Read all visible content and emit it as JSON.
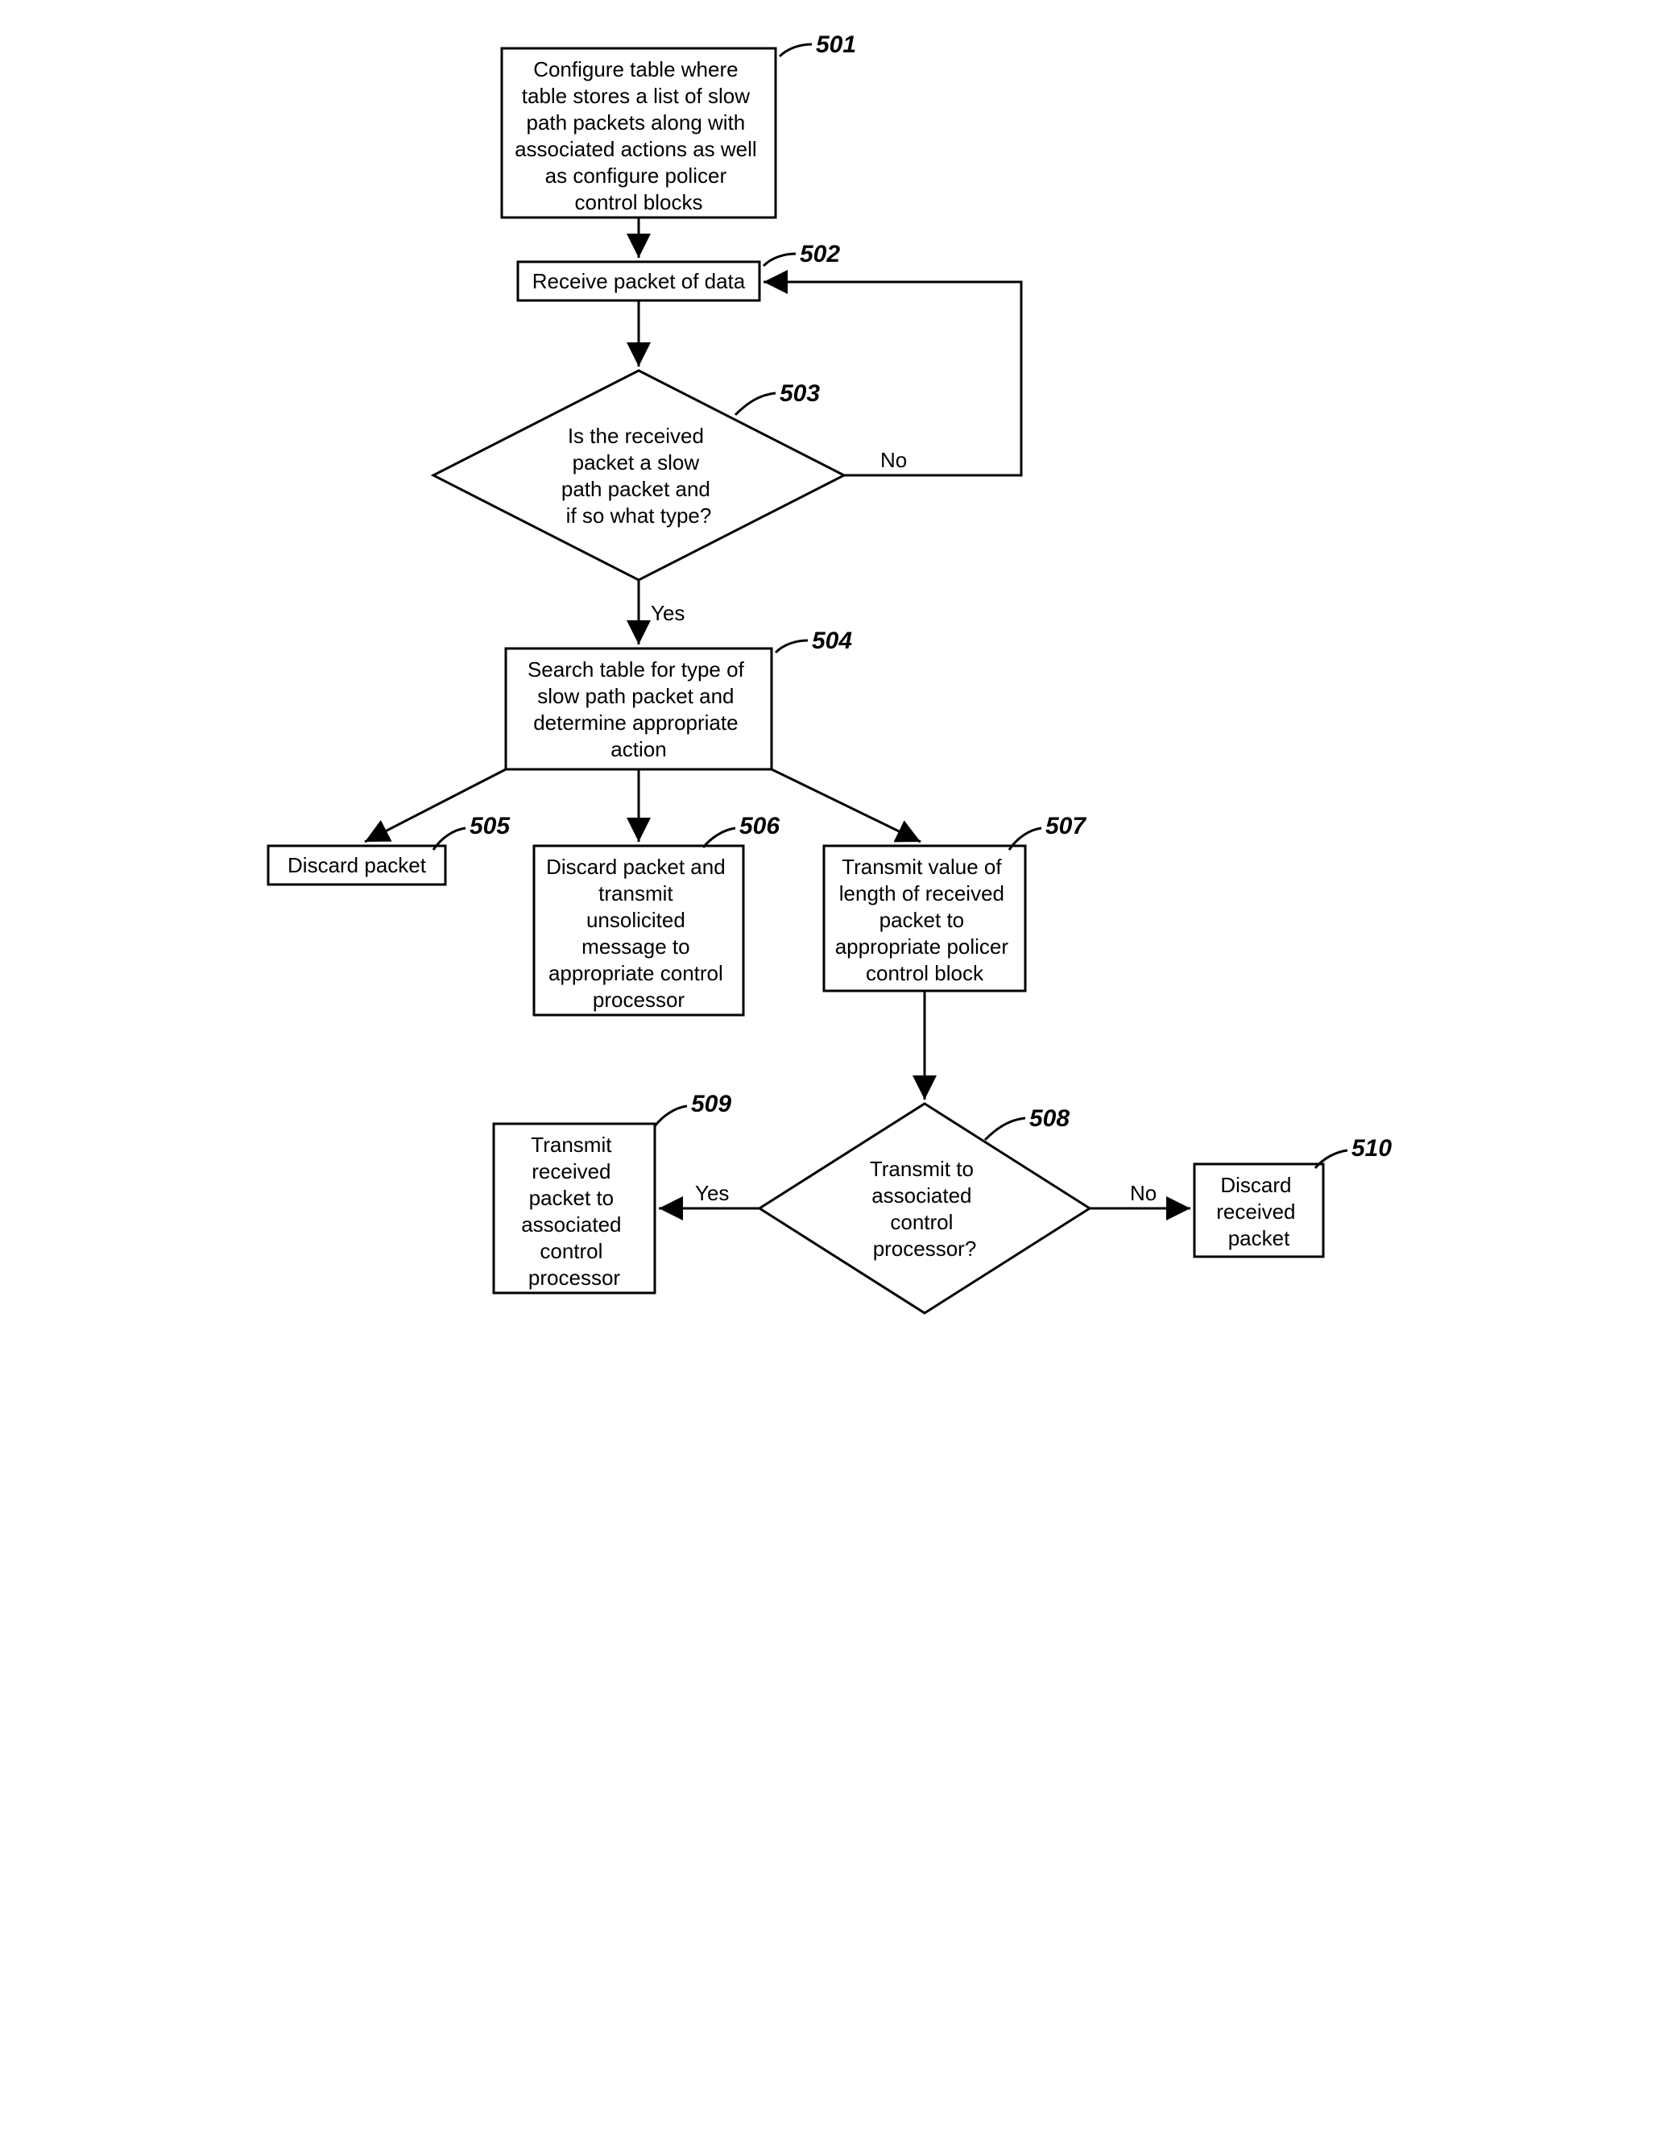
{
  "nodes": {
    "501": {
      "ref": "501",
      "lines": [
        "Configure table where",
        "table stores a list of slow",
        "path packets along with",
        "associated actions as well",
        "as configure policer",
        "control blocks"
      ]
    },
    "502": {
      "ref": "502",
      "lines": [
        "Receive packet of data"
      ]
    },
    "503": {
      "ref": "503",
      "lines": [
        "Is the received",
        "packet a slow",
        "path packet and",
        "if so what type?"
      ]
    },
    "504": {
      "ref": "504",
      "lines": [
        "Search table for type of",
        "slow path packet and",
        "determine appropriate",
        "action"
      ]
    },
    "505": {
      "ref": "505",
      "lines": [
        "Discard packet"
      ]
    },
    "506": {
      "ref": "506",
      "lines": [
        "Discard packet and",
        "transmit",
        "unsolicited",
        "message to",
        "appropriate control",
        "processor"
      ]
    },
    "507": {
      "ref": "507",
      "lines": [
        "Transmit value of",
        "length of received",
        "packet to",
        "appropriate policer",
        "control block"
      ]
    },
    "508": {
      "ref": "508",
      "lines": [
        "Transmit to",
        "associated",
        "control",
        "processor?"
      ]
    },
    "509": {
      "ref": "509",
      "lines": [
        "Transmit",
        "received",
        "packet to",
        "associated",
        "control",
        "processor"
      ]
    },
    "510": {
      "ref": "510",
      "lines": [
        "Discard",
        "received",
        "packet"
      ]
    }
  },
  "edges": {
    "yes": "Yes",
    "no": "No"
  }
}
